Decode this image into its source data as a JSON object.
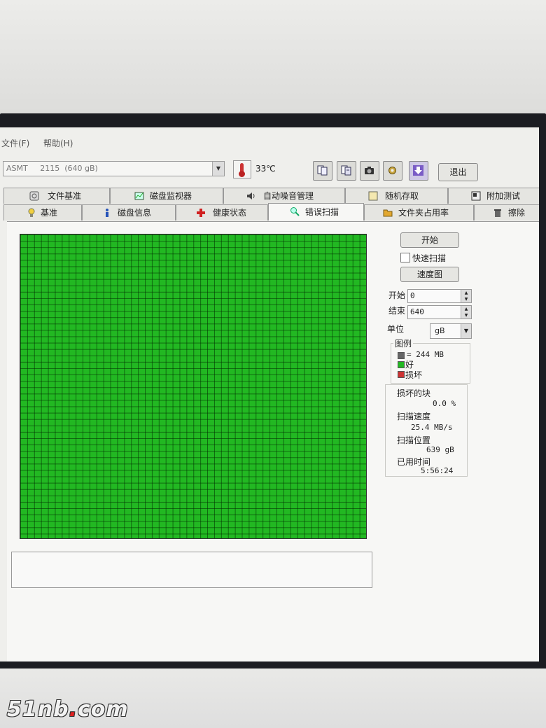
{
  "menu": {
    "file": "文件(F)",
    "help": "帮助(H)"
  },
  "drive": {
    "selected": "ASMT     2115  (640 gB)"
  },
  "temperature": "33℃",
  "toolbar": {
    "exit_label": "退出"
  },
  "tabs_row1": [
    {
      "label": "文件基准",
      "icon": "file-benchmark-icon"
    },
    {
      "label": "磁盘监视器",
      "icon": "disk-monitor-icon"
    },
    {
      "label": "自动噪音管理",
      "icon": "speaker-icon"
    },
    {
      "label": "随机存取",
      "icon": "random-access-icon"
    },
    {
      "label": "附加测试",
      "icon": "extra-tests-icon"
    }
  ],
  "tabs_row2": [
    {
      "label": "基准",
      "icon": "benchmark-icon"
    },
    {
      "label": "磁盘信息",
      "icon": "info-icon"
    },
    {
      "label": "健康状态",
      "icon": "health-cross-icon"
    },
    {
      "label": "错误扫描",
      "icon": "magnifier-icon",
      "active": true
    },
    {
      "label": "文件夹占用率",
      "icon": "folder-icon"
    },
    {
      "label": "擦除",
      "icon": "trash-icon"
    }
  ],
  "scan": {
    "start_button": "开始",
    "quick_scan_label": "快速扫描",
    "quick_scan_checked": false,
    "speed_map_button": "速度图",
    "start_label": "开始",
    "start_value": "0",
    "end_label": "结束",
    "end_value": "640",
    "unit_label": "单位",
    "unit_value": "gB"
  },
  "legend": {
    "title": "图例",
    "block_label": "= 244 MB",
    "good_label": "好",
    "bad_label": "损坏",
    "colors": {
      "block": "#666666",
      "good": "#22b822",
      "bad": "#cc3333"
    }
  },
  "stats": {
    "damaged_label": "损坏的块",
    "damaged_value": "0.0 %",
    "speed_label": "扫描速度",
    "speed_value": "25.4 MB/s",
    "position_label": "扫描位置",
    "position_value": "639 gB",
    "elapsed_label": "已用时间",
    "elapsed_value": "5:56:24"
  },
  "scan_map": {
    "good_fraction": 1.0,
    "color": "#22b822"
  },
  "watermark": {
    "text_main": "51nb",
    "text_dot": ".",
    "text_tail": "com"
  }
}
